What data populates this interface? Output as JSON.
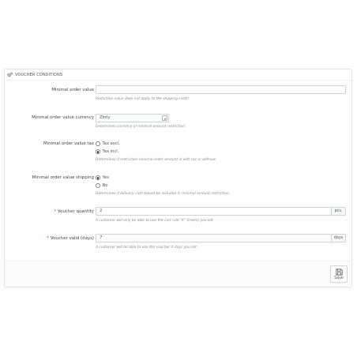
{
  "panel": {
    "title": "VOUCHER CONDITIONS",
    "icon": "cogs-icon"
  },
  "fields": {
    "min_order_value": {
      "label": "Minimal order value",
      "value": "",
      "help": "Reduction value does not apply to the shipping costs!"
    },
    "min_order_currency": {
      "label": "Minimal order value currency",
      "selected": "Złoty",
      "help": "Determines currency of minimal amount restriction."
    },
    "min_order_tax": {
      "label": "Minimal order value tax",
      "options": [
        "Tax excl.",
        "Tax incl."
      ],
      "selected_index": 1,
      "help": "Determines if restriction minimal order amount is with tax or without."
    },
    "min_order_shipping": {
      "label": "Minimal order value shipping",
      "options": [
        "Yes",
        "No"
      ],
      "selected_index": 0,
      "help": "Determines if delivery cost should be included in minimal amount restriction."
    },
    "voucher_quantity": {
      "required_mark": "*",
      "label": "Voucher quantity",
      "value": "2",
      "suffix": "pcs.",
      "help": "A customer will only be able to use the cart rule \"X\" time(s) you set."
    },
    "voucher_valid": {
      "required_mark": "*",
      "label": "Voucher valid (days)",
      "value": "7",
      "suffix": "days",
      "help": "A customer will be able to use the voucher X days you set."
    }
  },
  "footer": {
    "save_label": "Save",
    "save_icon": "floppy-disk-icon"
  },
  "colors": {
    "required": "#ee3322",
    "border": "#c7d6db",
    "help_text": "#8a8a8a"
  }
}
